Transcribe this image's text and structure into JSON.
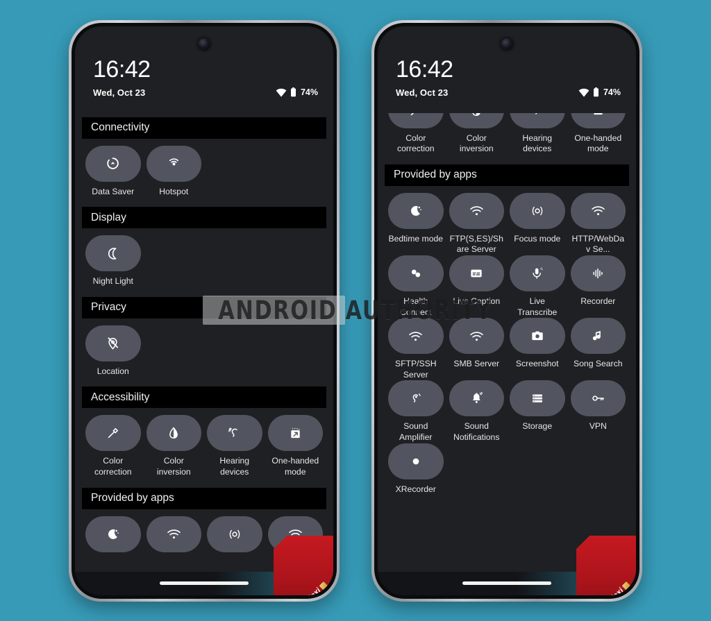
{
  "background_color": "#379bb8",
  "watermark": {
    "text": "ANDROID AUTHORITY"
  },
  "status_bar": {
    "time": "16:42",
    "date": "Wed, Oct 23",
    "battery_percent": "74%",
    "wifi_icon": "wifi-icon",
    "battery_icon": "battery-icon"
  },
  "ribbon": {
    "label": "flexi"
  },
  "phones": [
    {
      "id": "left",
      "name": "quick-settings-edit-top",
      "scrolled": false,
      "sections": [
        {
          "header": "Connectivity",
          "tiles": [
            {
              "label": "Data Saver",
              "icon": "data-saver-icon"
            },
            {
              "label": "Hotspot",
              "icon": "hotspot-icon"
            }
          ]
        },
        {
          "header": "Display",
          "tiles": [
            {
              "label": "Night Light",
              "icon": "moon-icon"
            }
          ]
        },
        {
          "header": "Privacy",
          "tiles": [
            {
              "label": "Location",
              "icon": "location-off-icon"
            }
          ]
        },
        {
          "header": "Accessibility",
          "tiles": [
            {
              "label": "Color correction",
              "icon": "eyedropper-icon"
            },
            {
              "label": "Color inversion",
              "icon": "contrast-droplet-icon"
            },
            {
              "label": "Hearing devices",
              "icon": "hearing-icon"
            },
            {
              "label": "One-handed mode",
              "icon": "one-handed-icon"
            }
          ]
        },
        {
          "header": "Provided by apps",
          "tiles": [
            {
              "label": "",
              "icon": "bedtime-icon"
            },
            {
              "label": "",
              "icon": "wifi-icon"
            },
            {
              "label": "",
              "icon": "focus-icon"
            },
            {
              "label": "",
              "icon": "wifi-icon"
            }
          ]
        }
      ]
    },
    {
      "id": "right",
      "name": "quick-settings-edit-scrolled",
      "scrolled": true,
      "sections": [
        {
          "header": "",
          "tiles": [
            {
              "label": "Color correction",
              "icon": "eyedropper-icon"
            },
            {
              "label": "Color inversion",
              "icon": "contrast-droplet-icon"
            },
            {
              "label": "Hearing devices",
              "icon": "hearing-icon"
            },
            {
              "label": "One-handed mode",
              "icon": "one-handed-icon"
            }
          ]
        },
        {
          "header": "Provided by apps",
          "tiles": [
            {
              "label": "Bedtime mode",
              "icon": "bedtime-icon"
            },
            {
              "label": "FTP(S,ES)/Share Server",
              "icon": "wifi-icon"
            },
            {
              "label": "Focus mode",
              "icon": "focus-icon"
            },
            {
              "label": "HTTP/WebDav Se...",
              "icon": "wifi-icon"
            },
            {
              "label": "Health Connect",
              "icon": "health-connect-icon"
            },
            {
              "label": "Live Caption",
              "icon": "live-caption-icon"
            },
            {
              "label": "Live Transcribe",
              "icon": "live-transcribe-icon"
            },
            {
              "label": "Recorder",
              "icon": "waveform-icon"
            },
            {
              "label": "SFTP/SSH Server",
              "icon": "wifi-icon"
            },
            {
              "label": "SMB Server",
              "icon": "wifi-icon"
            },
            {
              "label": "Screenshot",
              "icon": "camera-icon"
            },
            {
              "label": "Song Search",
              "icon": "music-note-icon"
            },
            {
              "label": "Sound Amplifier",
              "icon": "sound-amplifier-icon"
            },
            {
              "label": "Sound Notifications",
              "icon": "sound-notifications-icon"
            },
            {
              "label": "Storage",
              "icon": "storage-icon"
            },
            {
              "label": "VPN",
              "icon": "vpn-key-icon"
            },
            {
              "label": "XRecorder",
              "icon": "record-dot-icon"
            }
          ]
        }
      ]
    }
  ]
}
